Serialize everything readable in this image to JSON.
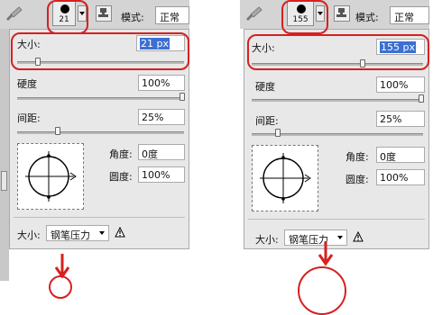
{
  "panels": [
    {
      "brush_size_display": "21",
      "mode_label": "模式:",
      "mode_value": "正常",
      "size_label": "大小:",
      "size_value": "21 px",
      "hardness_label": "硬度",
      "hardness_value": "100%",
      "hardness_level": 1.0,
      "spacing_label": "间距:",
      "spacing_value": "25%",
      "angle_label": "角度:",
      "angle_value": "0度",
      "roundness_label": "圆度:",
      "roundness_value": "100%",
      "size_control_label": "大小:",
      "size_control_value": "钢笔压力"
    },
    {
      "brush_size_display": "155",
      "mode_label": "模式:",
      "mode_value": "正常",
      "size_label": "大小:",
      "size_value": "155 px",
      "hardness_label": "硬度",
      "hardness_value": "100%",
      "hardness_level": 1.0,
      "spacing_label": "间距:",
      "spacing_value": "25%",
      "angle_label": "角度:",
      "angle_value": "0度",
      "roundness_label": "圆度:",
      "roundness_value": "100%",
      "size_control_label": "大小:",
      "size_control_value": "钢笔压力"
    }
  ],
  "icons": {
    "tool": "brush-icon",
    "stamp": "stamp-icon",
    "warning": "warning-icon",
    "angle_widget": "brush-angle-icon"
  },
  "colors": {
    "highlight": "#d62020",
    "selection": "#3b6fd3",
    "panel_bg": "#e8e8e8",
    "toolbar_bg": "#d4d4d4"
  }
}
